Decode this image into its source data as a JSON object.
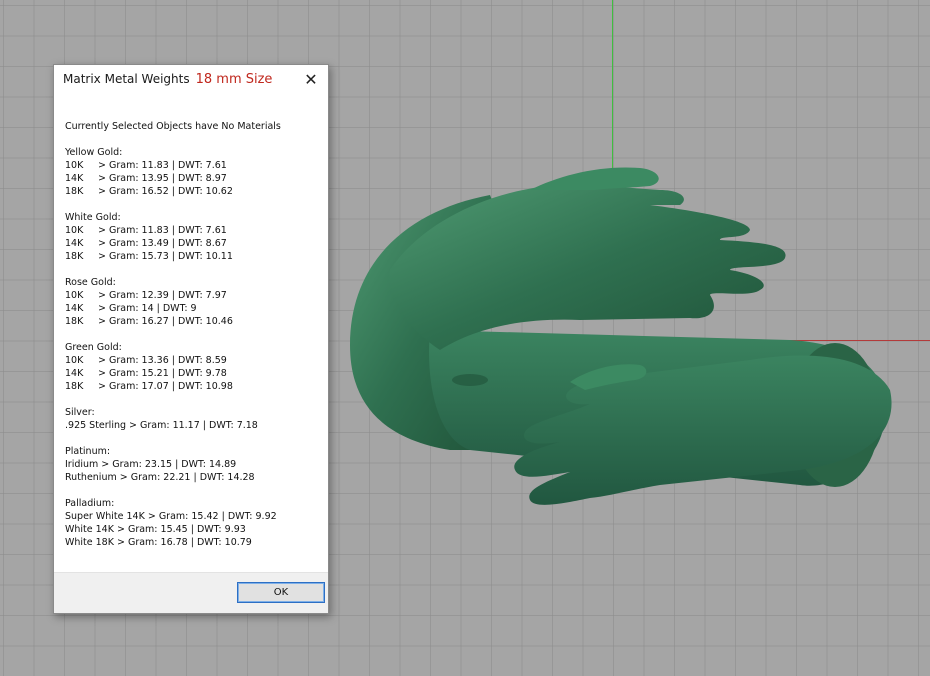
{
  "dialog": {
    "title": "Matrix Metal Weights",
    "title_accent": "18 mm Size",
    "headline": "Currently Selected Objects have No Materials",
    "groups": [
      {
        "name": "Yellow Gold:",
        "rows": [
          {
            "grade": "10K",
            "value": "> Gram: 11.83 | DWT: 7.61"
          },
          {
            "grade": "14K",
            "value": "> Gram: 13.95 | DWT: 8.97"
          },
          {
            "grade": "18K",
            "value": "> Gram: 16.52 | DWT: 10.62"
          }
        ]
      },
      {
        "name": "White Gold:",
        "rows": [
          {
            "grade": "10K",
            "value": "> Gram: 11.83 | DWT: 7.61"
          },
          {
            "grade": "14K",
            "value": "> Gram: 13.49 | DWT: 8.67"
          },
          {
            "grade": "18K",
            "value": "> Gram: 15.73 | DWT: 10.11"
          }
        ]
      },
      {
        "name": "Rose Gold:",
        "rows": [
          {
            "grade": "10K",
            "value": "> Gram: 12.39 | DWT: 7.97"
          },
          {
            "grade": "14K",
            "value": "> Gram: 14 | DWT: 9"
          },
          {
            "grade": "18K",
            "value": "> Gram: 16.27 | DWT: 10.46"
          }
        ]
      },
      {
        "name": "Green Gold:",
        "rows": [
          {
            "grade": "10K",
            "value": "> Gram: 13.36 | DWT: 8.59"
          },
          {
            "grade": "14K",
            "value": "> Gram: 15.21 | DWT: 9.78"
          },
          {
            "grade": "18K",
            "value": "> Gram: 17.07 | DWT: 10.98"
          }
        ]
      },
      {
        "name": "Silver:",
        "rows": [
          {
            "grade": "",
            "value": ".925 Sterling > Gram: 11.17 | DWT: 7.18"
          }
        ]
      },
      {
        "name": "Platinum:",
        "rows": [
          {
            "grade": "",
            "value": "Iridium > Gram: 23.15 | DWT: 14.89"
          },
          {
            "grade": "",
            "value": "Ruthenium > Gram: 22.21 | DWT: 14.28"
          }
        ]
      },
      {
        "name": "Palladium:",
        "rows": [
          {
            "grade": "",
            "value": "Super White 14K > Gram: 15.42 | DWT: 9.92"
          },
          {
            "grade": "",
            "value": "White 14K > Gram: 15.45 | DWT: 9.93"
          },
          {
            "grade": "",
            "value": "White 18K > Gram: 16.78 | DWT: 10.79"
          }
        ]
      }
    ],
    "ok_label": "OK",
    "close_icon": "close-icon"
  },
  "colors": {
    "accent_title": "#c0281e",
    "model_green": "#2e6b4a",
    "axis_green": "#3fbf3f",
    "axis_red": "#b33a3a"
  }
}
